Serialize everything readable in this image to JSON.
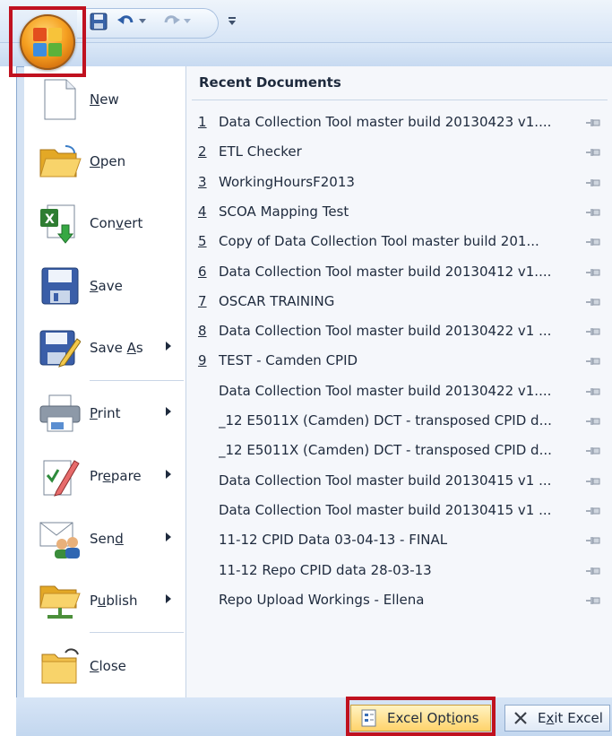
{
  "commands": [
    {
      "id": "new",
      "before": "",
      "key": "N",
      "after": "ew",
      "submenu": false
    },
    {
      "id": "open",
      "before": "",
      "key": "O",
      "after": "pen",
      "submenu": false
    },
    {
      "id": "convert",
      "before": "Con",
      "key": "v",
      "after": "ert",
      "submenu": false
    },
    {
      "id": "save",
      "before": "",
      "key": "S",
      "after": "ave",
      "submenu": false
    },
    {
      "id": "save-as",
      "before": "Save ",
      "key": "A",
      "after": "s",
      "submenu": true
    },
    {
      "id": "print",
      "before": "",
      "key": "P",
      "after": "rint",
      "submenu": true
    },
    {
      "id": "prepare",
      "before": "Pr",
      "key": "e",
      "after": "pare",
      "submenu": true
    },
    {
      "id": "send",
      "before": "Sen",
      "key": "d",
      "after": "",
      "submenu": true
    },
    {
      "id": "publish",
      "before": "P",
      "key": "u",
      "after": "blish",
      "submenu": true
    },
    {
      "id": "close",
      "before": "",
      "key": "C",
      "after": "lose",
      "submenu": false
    }
  ],
  "recent": {
    "title": "Recent Documents",
    "items": [
      {
        "num": "1",
        "name": "Data Collection Tool master build 20130423 v1...."
      },
      {
        "num": "2",
        "name": "ETL Checker"
      },
      {
        "num": "3",
        "name": "WorkingHoursF2013"
      },
      {
        "num": "4",
        "name": "SCOA Mapping Test"
      },
      {
        "num": "5",
        "name": "Copy of Data Collection Tool master build 201..."
      },
      {
        "num": "6",
        "name": "Data Collection Tool master build 20130412 v1...."
      },
      {
        "num": "7",
        "name": "OSCAR TRAINING"
      },
      {
        "num": "8",
        "name": "Data Collection Tool master build 20130422 v1 ..."
      },
      {
        "num": "9",
        "name": "TEST - Camden CPID"
      },
      {
        "num": "",
        "name": "Data Collection Tool master build 20130422 v1...."
      },
      {
        "num": "",
        "name": "_12 E5011X (Camden) DCT - transposed CPID d..."
      },
      {
        "num": "",
        "name": "_12 E5011X (Camden) DCT - transposed CPID d..."
      },
      {
        "num": "",
        "name": "Data Collection Tool master build 20130415 v1 ..."
      },
      {
        "num": "",
        "name": "Data Collection Tool master build 20130415 v1 ..."
      },
      {
        "num": "",
        "name": "11-12 CPID Data 03-04-13 - FINAL"
      },
      {
        "num": "",
        "name": "11-12 Repo CPID data 28-03-13"
      },
      {
        "num": "",
        "name": "Repo Upload Workings - Ellena"
      }
    ]
  },
  "footer": {
    "options": {
      "before": "Excel Opt",
      "key": "i",
      "after": "ons"
    },
    "exit": {
      "before": "E",
      "key": "x",
      "after": "it Excel"
    }
  },
  "icons": {
    "office": "office-logo-icon",
    "save_qat": "floppy-icon",
    "undo": "undo-icon",
    "redo": "redo-icon",
    "customize": "customize-qat-icon",
    "pin": "pushpin-icon"
  },
  "colors": {
    "highlight": "#c0111f",
    "office_orange": "#f5a021",
    "accent_blue": "#3b6fb6"
  }
}
